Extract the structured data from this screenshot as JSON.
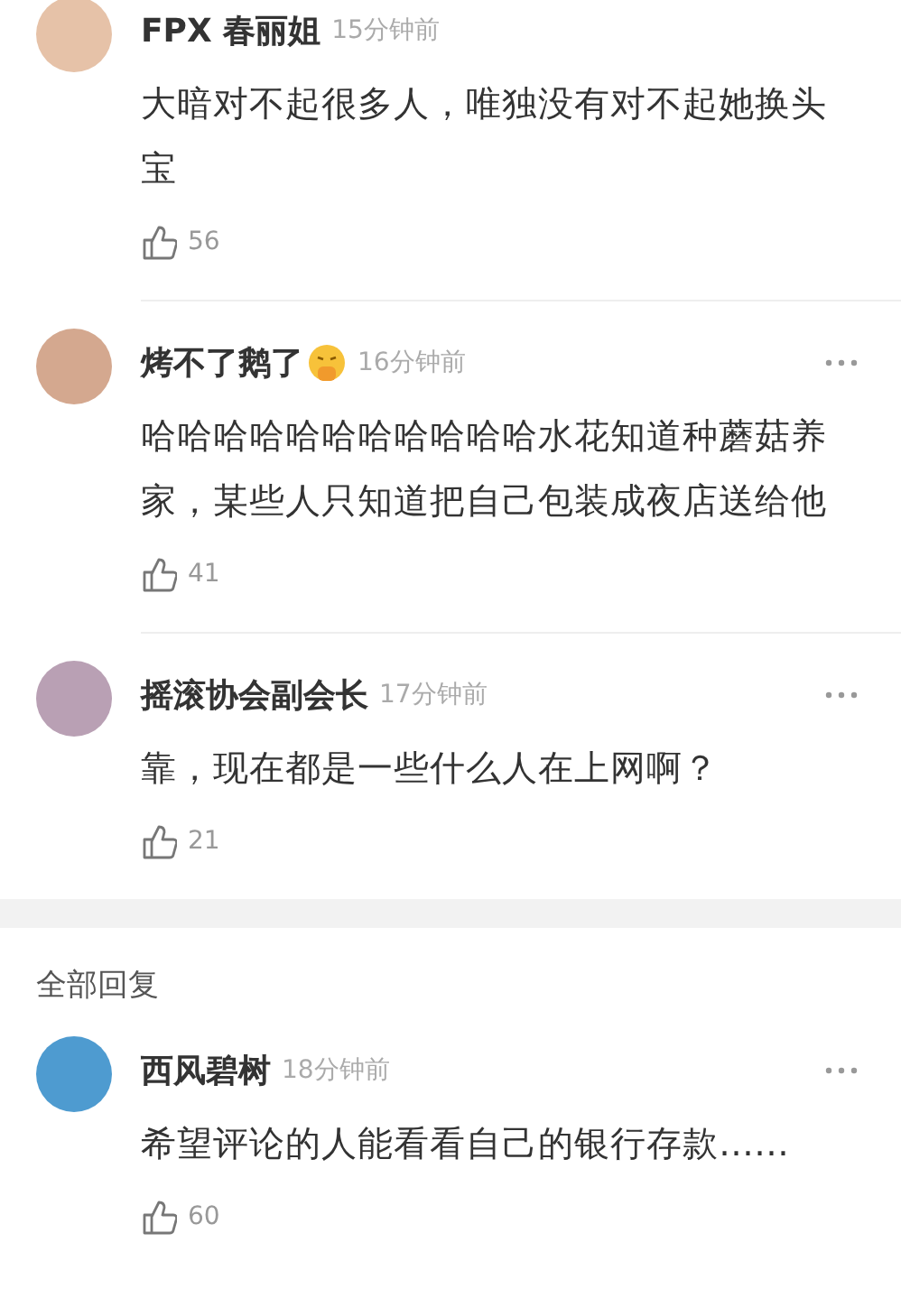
{
  "comments": [
    {
      "author": "FPX 春丽姐",
      "time": "15分钟前",
      "emoji": false,
      "color": "#e6c2a8",
      "more": false,
      "text": "大暗对不起很多人，唯独没有对不起她换头宝",
      "likes": "56"
    },
    {
      "author": "烤不了鹅了",
      "time": "16分钟前",
      "emoji": true,
      "color": "#d4a88f",
      "more": true,
      "text": "哈哈哈哈哈哈哈哈哈哈哈水花知道种蘑菇养家，某些人只知道把自己包装成夜店送给他",
      "likes": "41"
    },
    {
      "author": "摇滚协会副会长",
      "time": "17分钟前",
      "emoji": false,
      "color": "#b9a0b4",
      "more": true,
      "text": "靠，现在都是一些什么人在上网啊？",
      "likes": "21"
    }
  ],
  "all_replies": {
    "title": "全部回复",
    "comments": [
      {
        "author": "西风碧树",
        "time": "18分钟前",
        "emoji": false,
        "color": "#4e9bd0",
        "more": true,
        "text": "希望评论的人能看看自己的银行存款……",
        "likes": "60"
      }
    ]
  }
}
